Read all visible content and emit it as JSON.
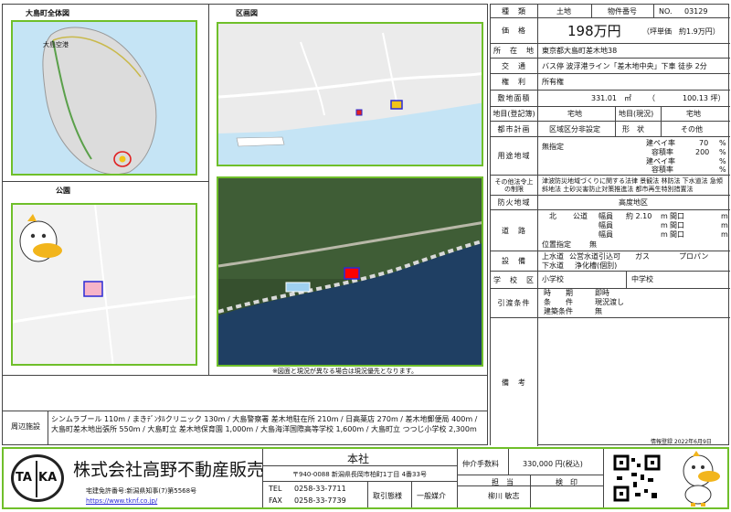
{
  "left": {
    "island_title": "大島町全体図",
    "island_label": "大島空港",
    "area_title": "区画図",
    "park_title": "公園",
    "photo_note": "※図面と現況が異なる場合は現況優先となります。",
    "surroundings_label": "周辺施設",
    "surroundings_text": "シンムラブール 110m / まきﾃﾞﾝﾀﾙクリニック 130m / 大島警察署 差木地駐在所 210m / 日高薬店 270m / 差木地郵便局 400m / 大島町差木地出張所 550m / 大島町立 差木地保育園 1,000m / 大島海洋国際高等学校 1,600m / 大島町立 つつじ小学校 2,300m"
  },
  "table": {
    "type_label": "種　類",
    "type_value": "土地",
    "property_no_label": "物件番号",
    "no_label": "NO.",
    "no_value": "03129",
    "price_label": "価　格",
    "price_value": "198万円",
    "unit_price": "（坪単価　約1.9万円）",
    "location_label": "所　在　地",
    "location_value": "東京都大島町差木地38",
    "transport_label": "交　通",
    "transport_value": "バス停 波浮港ライン「差木地中央」下車 徒歩 2分",
    "rights_label": "権　利",
    "rights_value": "所有権",
    "area_label": "敷地面積",
    "area_sqm": "331.01　㎡",
    "area_paren_open": "（",
    "area_tsubo": "100.13 坪）",
    "registry_label": "地目(登記簿)",
    "registry_value": "宅地",
    "current_label": "地目(現況)",
    "current_value": "宅地",
    "city_plan_label": "都市計画",
    "city_plan_value": "区域区分非設定",
    "shape_label": "形　状",
    "shape_value": "その他",
    "zoning_label": "用途地域",
    "zoning_value": "無指定",
    "bcr_label": "建ペイ率",
    "bcr_value": "70",
    "far_label": "容積率",
    "far_value": "200",
    "pct": "%",
    "restrictions_label": "その他法令上の制限",
    "restrictions_value": "津波防災地域づくりに関する法律 景観法 林防法 下水道法 急傾斜地法 土砂災害防止対策推進法 都市再生特別措置法",
    "fire_label": "防火地域",
    "fire_value": "高度地区",
    "road_label": "道　路",
    "road_dir": "北",
    "road_type": "公道",
    "road_width_label": "幅員",
    "road_width_value": "約 2.10",
    "road_m": "m",
    "road_frontage_label": "間口",
    "road_frontage_unit": "m",
    "position_label": "位置指定",
    "position_value": "無",
    "facilities_label": "設　備",
    "water_label": "上水道",
    "water_value": "公営水道引込可",
    "gas_label": "ガス",
    "gas_value": "プロパン",
    "sewer_label": "下水道",
    "sewer_value": "浄化槽(個別)",
    "school_label": "学　校　区",
    "elem_label": "小学校",
    "junior_label": "中学校",
    "delivery_label": "引渡条件",
    "timing_label": "時　　期",
    "timing_value": "即時",
    "cond_label": "条　　件",
    "cond_value": "現況渡し",
    "build_cond_label": "建築条件",
    "build_cond_value": "無",
    "notes_label": "備　考",
    "info_date": "情報登録 2022年6月9日"
  },
  "footer": {
    "logo_ta": "TA",
    "logo_ka": "KA",
    "company": "株式会社高野不動産販売",
    "license": "宅建免許番号:新潟県知事(7)第5568号",
    "url": "https://www.tknf.co.jp/",
    "branch": "本社",
    "address": "〒940-0088 新潟県長岡市柏町1丁目 4番33号",
    "tel_label": "TEL",
    "tel": "0258-33-7711",
    "fax_label": "FAX",
    "fax": "0258-33-7739",
    "deal_label": "取引態様",
    "deal_value": "一般媒介",
    "fee_label": "仲介手数料",
    "fee_value": "330,000 円(税込)",
    "staff_label": "担　当",
    "check_label": "検　印",
    "staff_value": "柳川 敏志"
  },
  "colors": {
    "frame_green": "#6fbf2a",
    "sea_blue": "#c5e4f5",
    "map_bg": "#e9e9e9",
    "plot_red": "#ff0000",
    "mark_blue": "#2b2bd6"
  }
}
